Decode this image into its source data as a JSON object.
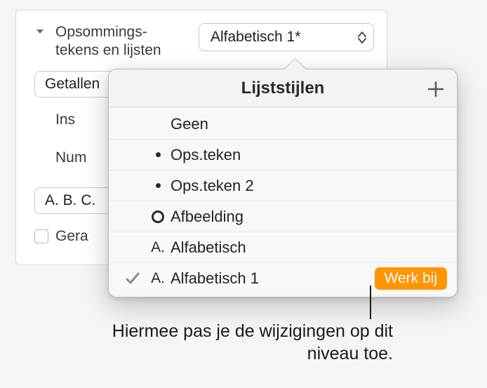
{
  "panel": {
    "label": "Opsommings-\ntekens en lijsten",
    "select_value": "Alfabetisch 1*",
    "type_select": "Getallen",
    "indent_label": "Ins",
    "num_label": "Num",
    "abc_label": "A. B. C.",
    "checkbox_label": "Gera"
  },
  "popover": {
    "title": "Lijststijlen",
    "items": {
      "none": "Geen",
      "bullet1": "Ops.teken",
      "bullet2": "Ops.teken 2",
      "image": "Afbeelding",
      "alpha": "Alfabetisch",
      "alpha1": "Alfabetisch 1"
    },
    "update_btn": "Werk bij"
  },
  "callout": "Hiermee pas je de wijzigingen op dit niveau toe."
}
